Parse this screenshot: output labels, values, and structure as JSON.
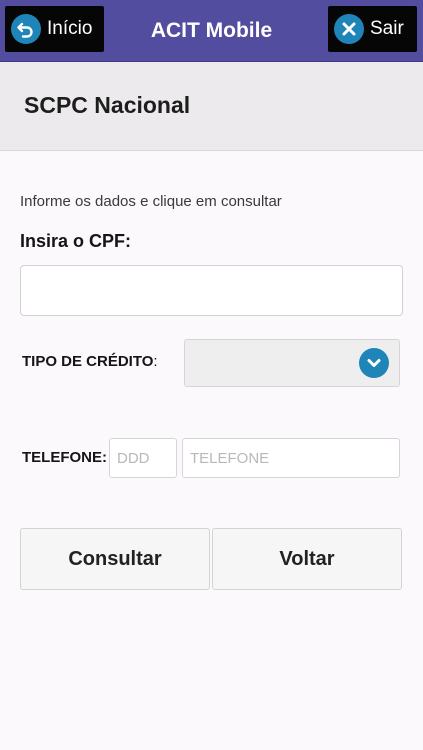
{
  "header": {
    "home_label": "Início",
    "app_title": "ACIT Mobile",
    "exit_label": "Sair"
  },
  "page": {
    "title": "SCPC Nacional"
  },
  "form": {
    "instruction": "Informe os dados e clique em consultar",
    "cpf_label": "Insira o CPF:",
    "cpf_value": "",
    "tipo_credito_label": "TIPO DE CRÉDITO",
    "tipo_credito_suffix": ":",
    "tipo_credito_selected": "",
    "telefone_label": "TELEFONE:",
    "ddd_placeholder": "DDD",
    "telefone_placeholder": "TELEFONE"
  },
  "actions": {
    "consultar_label": "Consultar",
    "voltar_label": "Voltar"
  },
  "colors": {
    "header_bg": "#524d9f",
    "icon_blue": "#1f84b8"
  },
  "icons": {
    "home": "back-arrow-icon",
    "exit": "close-icon",
    "select": "chevron-down-icon"
  }
}
